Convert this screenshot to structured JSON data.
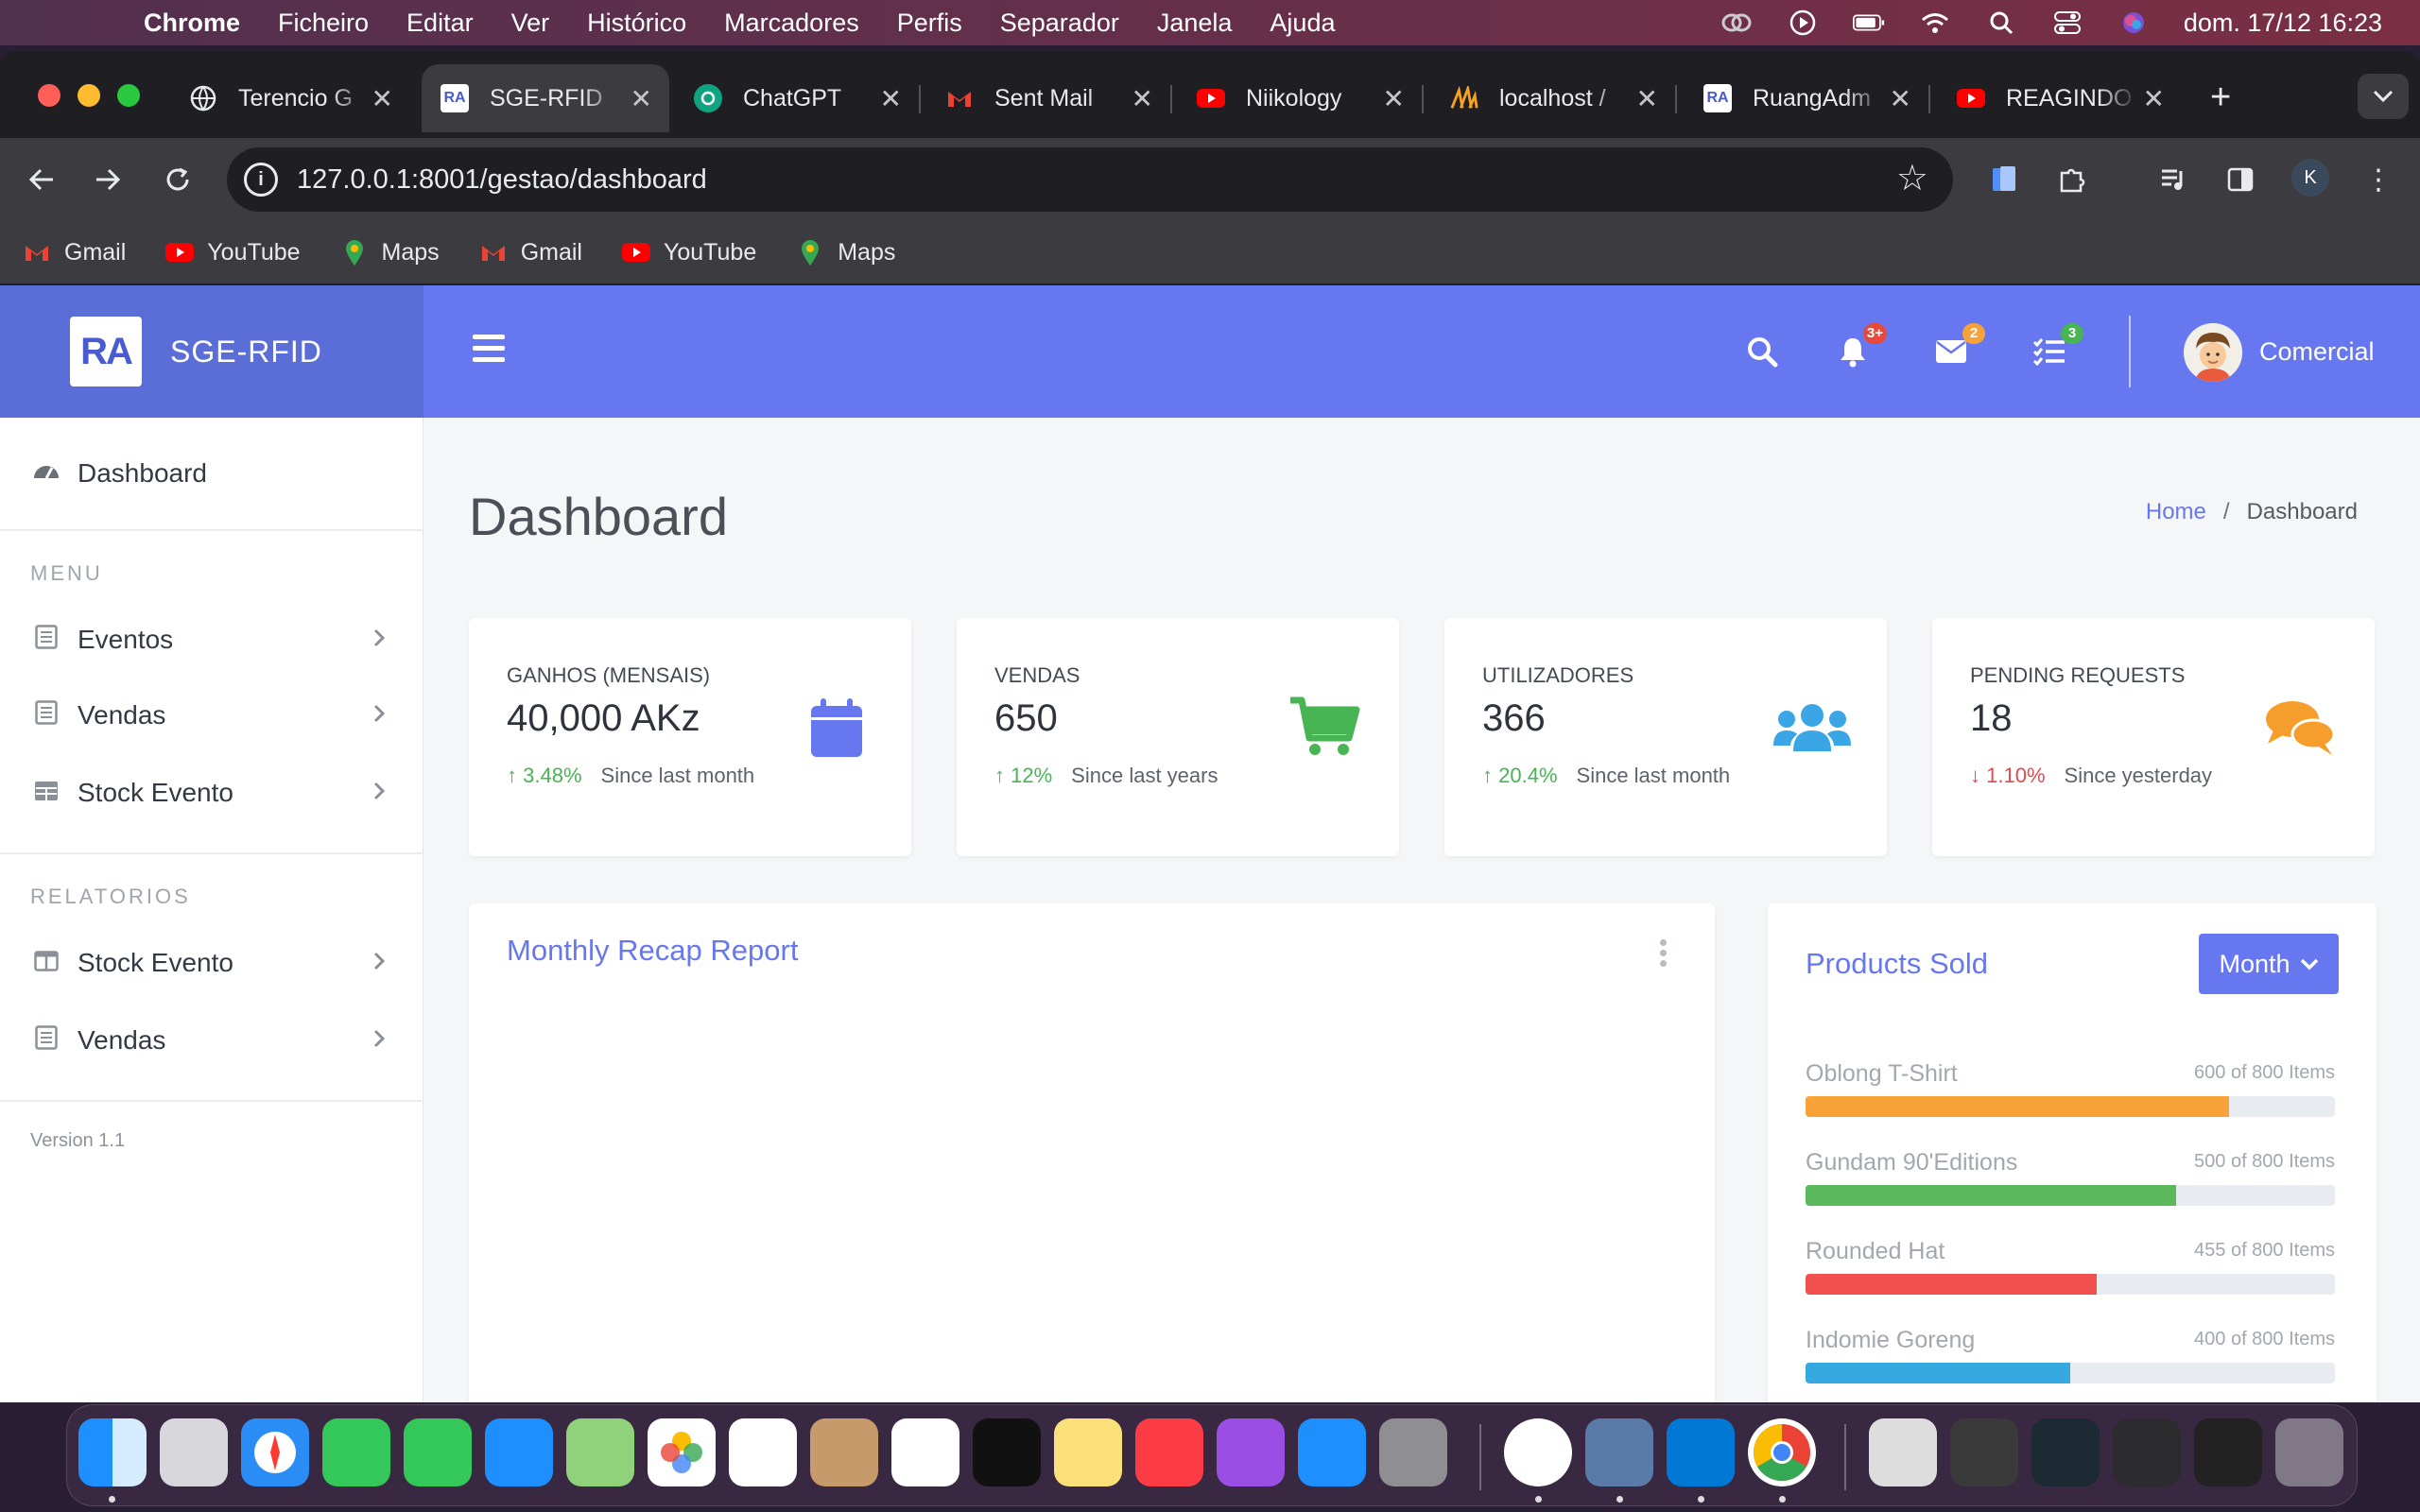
{
  "menubar": {
    "app": "Chrome",
    "items": [
      "Ficheiro",
      "Editar",
      "Ver",
      "Histórico",
      "Marcadores",
      "Perfis",
      "Separador",
      "Janela",
      "Ajuda"
    ],
    "datetime": "dom. 17/12  16:23"
  },
  "tabs": [
    {
      "label": "Terencio G",
      "icon": "globe-icon"
    },
    {
      "label": "SGE-RFID",
      "icon": "ra-logo-icon",
      "active": true
    },
    {
      "label": "ChatGPT",
      "icon": "chatgpt-icon"
    },
    {
      "label": "Sent Mail",
      "icon": "gmail-icon"
    },
    {
      "label": "Niikology",
      "icon": "youtube-icon"
    },
    {
      "label": "localhost /",
      "icon": "phpmyadmin-icon"
    },
    {
      "label": "RuangAdm",
      "icon": "ra-logo-icon"
    },
    {
      "label": "REAGINDO",
      "icon": "youtube-icon"
    }
  ],
  "address": {
    "url": "127.0.0.1:8001/gestao/dashboard"
  },
  "profile_initial": "K",
  "bookmarks": [
    {
      "label": "Gmail",
      "icon": "gmail-icon"
    },
    {
      "label": "YouTube",
      "icon": "youtube-icon"
    },
    {
      "label": "Maps",
      "icon": "maps-icon"
    },
    {
      "label": "Gmail",
      "icon": "gmail-icon"
    },
    {
      "label": "YouTube",
      "icon": "youtube-icon"
    },
    {
      "label": "Maps",
      "icon": "maps-icon"
    }
  ],
  "brand": {
    "logo": "RA",
    "name": "SGE-RFID"
  },
  "topnav": {
    "notifications_badge": "3+",
    "messages_badge": "2",
    "tasks_badge": "3",
    "user_name": "Comercial"
  },
  "sidebar": {
    "dashboard": "Dashboard",
    "menu_heading": "MENU",
    "menu_items": [
      "Eventos",
      "Vendas",
      "Stock Evento"
    ],
    "reports_heading": "RELATORIOS",
    "report_items": [
      "Stock Evento",
      "Vendas"
    ],
    "version": "Version 1.1"
  },
  "header": {
    "title": "Dashboard",
    "breadcrumb_home": "Home",
    "breadcrumb_current": "Dashboard"
  },
  "stats": [
    {
      "label": "GANHOS (MENSAIS)",
      "value": "40,000 AKz",
      "delta": "3.48%",
      "direction": "up",
      "note": "Since last month",
      "icon": "calendar-icon",
      "color": "#6777ef"
    },
    {
      "label": "VENDAS",
      "value": "650",
      "delta": "12%",
      "direction": "up",
      "note": "Since last years",
      "icon": "cart-icon",
      "color": "#47b553"
    },
    {
      "label": "UTILIZADORES",
      "value": "366",
      "delta": "20.4%",
      "direction": "up",
      "note": "Since last month",
      "icon": "users-icon",
      "color": "#3ba6e6"
    },
    {
      "label": "PENDING REQUESTS",
      "value": "18",
      "delta": "1.10%",
      "direction": "down",
      "note": "Since yesterday",
      "icon": "comments-icon",
      "color": "#f59e2c"
    }
  ],
  "recap": {
    "title": "Monthly Recap Report"
  },
  "products": {
    "title": "Products Sold",
    "period_button": "Month",
    "items": [
      {
        "name": "Oblong T-Shirt",
        "count": "600 of 800 Items",
        "fraction": 0.8,
        "color": "#f8a23a"
      },
      {
        "name": "Gundam 90'Editions",
        "count": "500 of 800 Items",
        "fraction": 0.7,
        "color": "#5cb85c"
      },
      {
        "name": "Rounded Hat",
        "count": "455 of 800 Items",
        "fraction": 0.55,
        "color": "#f0514f"
      },
      {
        "name": "Indomie Goreng",
        "count": "400 of 800 Items",
        "fraction": 0.5,
        "color": "#36a9e1"
      }
    ]
  }
}
